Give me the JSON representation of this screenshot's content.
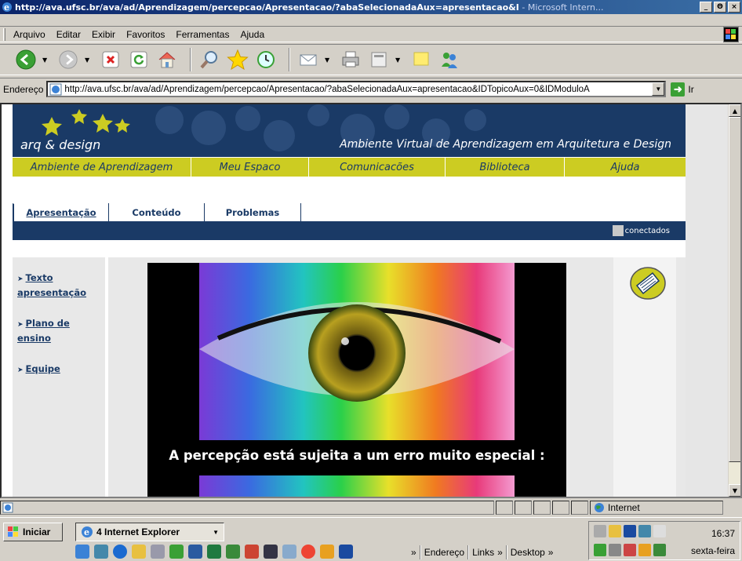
{
  "window": {
    "title": "http://ava.ufsc.br/ava/ad/Aprendizagem/percepcao/Apresentacao/?abaSelecionadaAux=apresentacao&I",
    "title_app": " - Microsoft Intern...",
    "min_label": "_",
    "max_label": "Θ",
    "close_label": "×"
  },
  "menu": {
    "items": [
      "Arquivo",
      "Editar",
      "Exibir",
      "Favoritos",
      "Ferramentas",
      "Ajuda"
    ]
  },
  "address": {
    "label": "Endereço",
    "url": "http://ava.ufsc.br/ava/ad/Aprendizagem/percepcao/Apresentacao/?abaSelecionadaAux=apresentacao&IDTopicoAux=0&IDModuloA",
    "go_label": "Ir"
  },
  "site": {
    "logo_text": "arq & design",
    "tagline": "Ambiente Virtual de Aprendizagem em Arquitetura e Design",
    "nav": [
      "Ambiente de Aprendizagem",
      "Meu Espaco",
      "Comunicacões",
      "Biblioteca",
      "Ajuda"
    ],
    "tabs": [
      "Apresentação",
      "Conteúdo",
      "Problemas"
    ],
    "online_label": "conectados",
    "left_links": [
      "Texto apresentação",
      "Plano de ensino",
      "Equipe"
    ],
    "hero_caption": "A percepção está sujeita a um erro muito especial :"
  },
  "statusbar": {
    "zone": "Internet"
  },
  "taskbar": {
    "start": "Iniciar",
    "task": "4 Internet Explorer",
    "endereco": "Endereço",
    "links": "Links",
    "desktop": "Desktop",
    "chevron": "»",
    "time": "16:37",
    "day": "sexta-feira"
  },
  "colors": {
    "brand_navy": "#1a3a66",
    "brand_yellow": "#cccc22"
  }
}
